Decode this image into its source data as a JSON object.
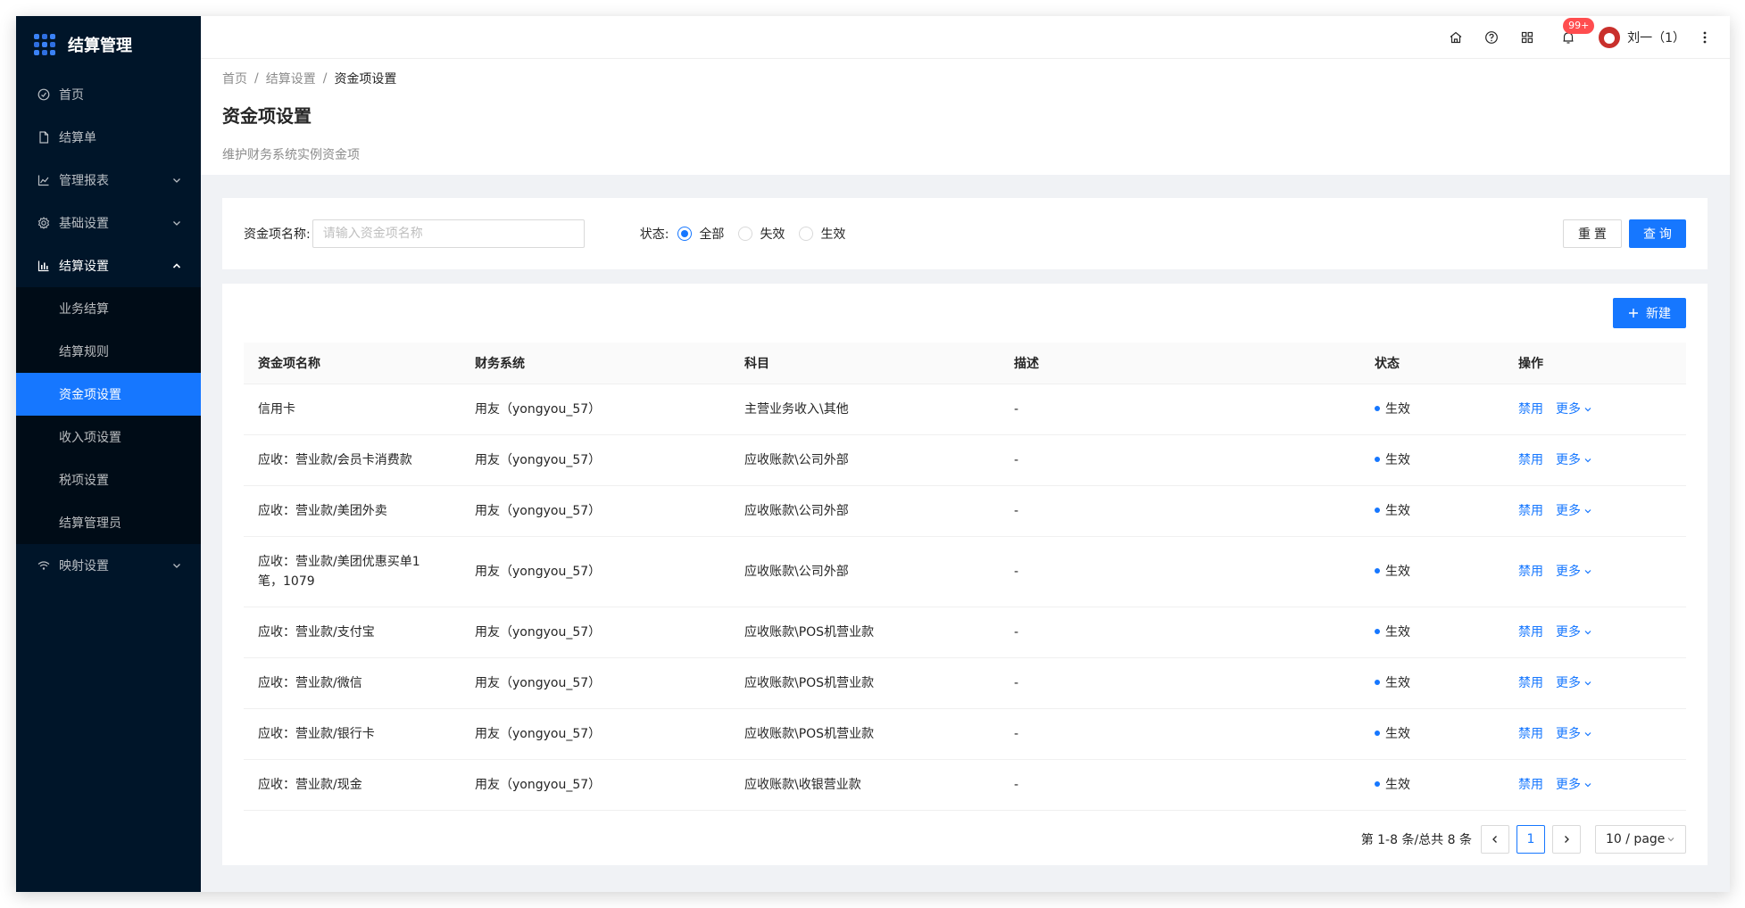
{
  "app": {
    "title": "结算管理"
  },
  "sidebar": {
    "items": [
      {
        "label": "首页"
      },
      {
        "label": "结算单"
      },
      {
        "label": "管理报表"
      },
      {
        "label": "基础设置"
      },
      {
        "label": "结算设置"
      },
      {
        "label": "映射设置"
      }
    ],
    "sub_items": [
      {
        "label": "业务结算"
      },
      {
        "label": "结算规则"
      },
      {
        "label": "资金项设置"
      },
      {
        "label": "收入项设置"
      },
      {
        "label": "税项设置"
      },
      {
        "label": "结算管理员"
      }
    ]
  },
  "header": {
    "badge": "99+",
    "user_name": "刘一（1）"
  },
  "breadcrumb": [
    "首页",
    "结算设置",
    "资金项设置"
  ],
  "breadcrumb_sep": "/",
  "page": {
    "title": "资金项设置",
    "description": "维护财务系统实例资金项"
  },
  "search": {
    "name_label": "资金项名称:",
    "name_placeholder": "请输入资金项名称",
    "name_value": "",
    "status_label": "状态:",
    "status_options": [
      "全部",
      "失效",
      "生效"
    ],
    "status_selected": "全部",
    "reset_label": "重 置",
    "query_label": "查 询"
  },
  "toolbar": {
    "new_label": "新建"
  },
  "table": {
    "columns": [
      "资金项名称",
      "财务系统",
      "科目",
      "描述",
      "状态",
      "操作"
    ],
    "action_disable": "禁用",
    "action_more": "更多",
    "rows": [
      {
        "name": "信用卡",
        "system": "用友（yongyou_57）",
        "subject": "主营业务收入\\其他",
        "desc": "-",
        "status": "生效"
      },
      {
        "name": "应收：营业款/会员卡消费款",
        "system": "用友（yongyou_57）",
        "subject": "应收账款\\公司外部",
        "desc": "-",
        "status": "生效"
      },
      {
        "name": "应收：营业款/美团外卖",
        "system": "用友（yongyou_57）",
        "subject": "应收账款\\公司外部",
        "desc": "-",
        "status": "生效"
      },
      {
        "name": "应收：营业款/美团优惠买单1笔，1079",
        "system": "用友（yongyou_57）",
        "subject": "应收账款\\公司外部",
        "desc": "-",
        "status": "生效"
      },
      {
        "name": "应收：营业款/支付宝",
        "system": "用友（yongyou_57）",
        "subject": "应收账款\\POS机营业款",
        "desc": "-",
        "status": "生效"
      },
      {
        "name": "应收：营业款/微信",
        "system": "用友（yongyou_57）",
        "subject": "应收账款\\POS机营业款",
        "desc": "-",
        "status": "生效"
      },
      {
        "name": "应收：营业款/银行卡",
        "system": "用友（yongyou_57）",
        "subject": "应收账款\\POS机营业款",
        "desc": "-",
        "status": "生效"
      },
      {
        "name": "应收：营业款/现金",
        "system": "用友（yongyou_57）",
        "subject": "应收账款\\收银营业款",
        "desc": "-",
        "status": "生效"
      }
    ]
  },
  "pagination": {
    "summary": "第 1-8 条/总共 8 条",
    "current_page": "1",
    "page_size": "10 / page"
  },
  "colors": {
    "primary": "#1677ff",
    "sider": "#001529",
    "badge": "#ff4d4f"
  }
}
